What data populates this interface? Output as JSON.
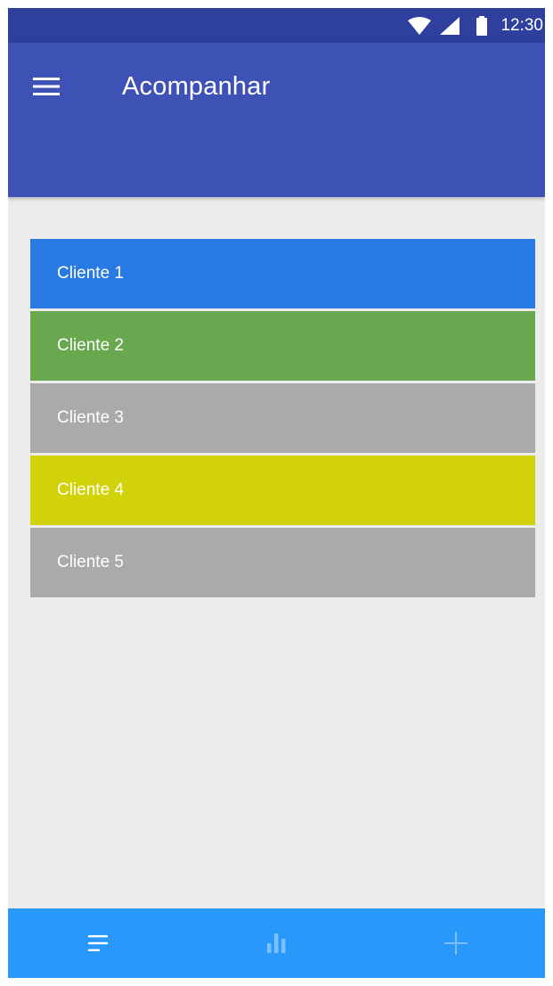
{
  "status_bar": {
    "time": "12:30",
    "icons": [
      "wifi-icon",
      "cellular-signal-icon",
      "battery-icon"
    ],
    "background": "#2f3f9e"
  },
  "app_bar": {
    "title": "Acompanhar",
    "menu_icon": "menu-icon",
    "background": "#3e51b5"
  },
  "clients": [
    {
      "label": "Cliente 1",
      "color": "#2a7ae4"
    },
    {
      "label": "Cliente 2",
      "color": "#69a84f"
    },
    {
      "label": "Cliente 3",
      "color": "#aaaaaa"
    },
    {
      "label": "Cliente 4",
      "color": "#d2d20b"
    },
    {
      "label": "Cliente 5",
      "color": "#aaaaaa"
    }
  ],
  "bottom_nav": {
    "background": "#2899fb",
    "items": [
      {
        "icon": "list-icon",
        "active": true
      },
      {
        "icon": "bar-chart-icon",
        "active": false
      },
      {
        "icon": "add-icon",
        "active": false
      }
    ]
  },
  "colors": {
    "content_background": "#ececec",
    "nav_icon_active": "#ffffff",
    "nav_icon_inactive": "#7cc1fd"
  }
}
